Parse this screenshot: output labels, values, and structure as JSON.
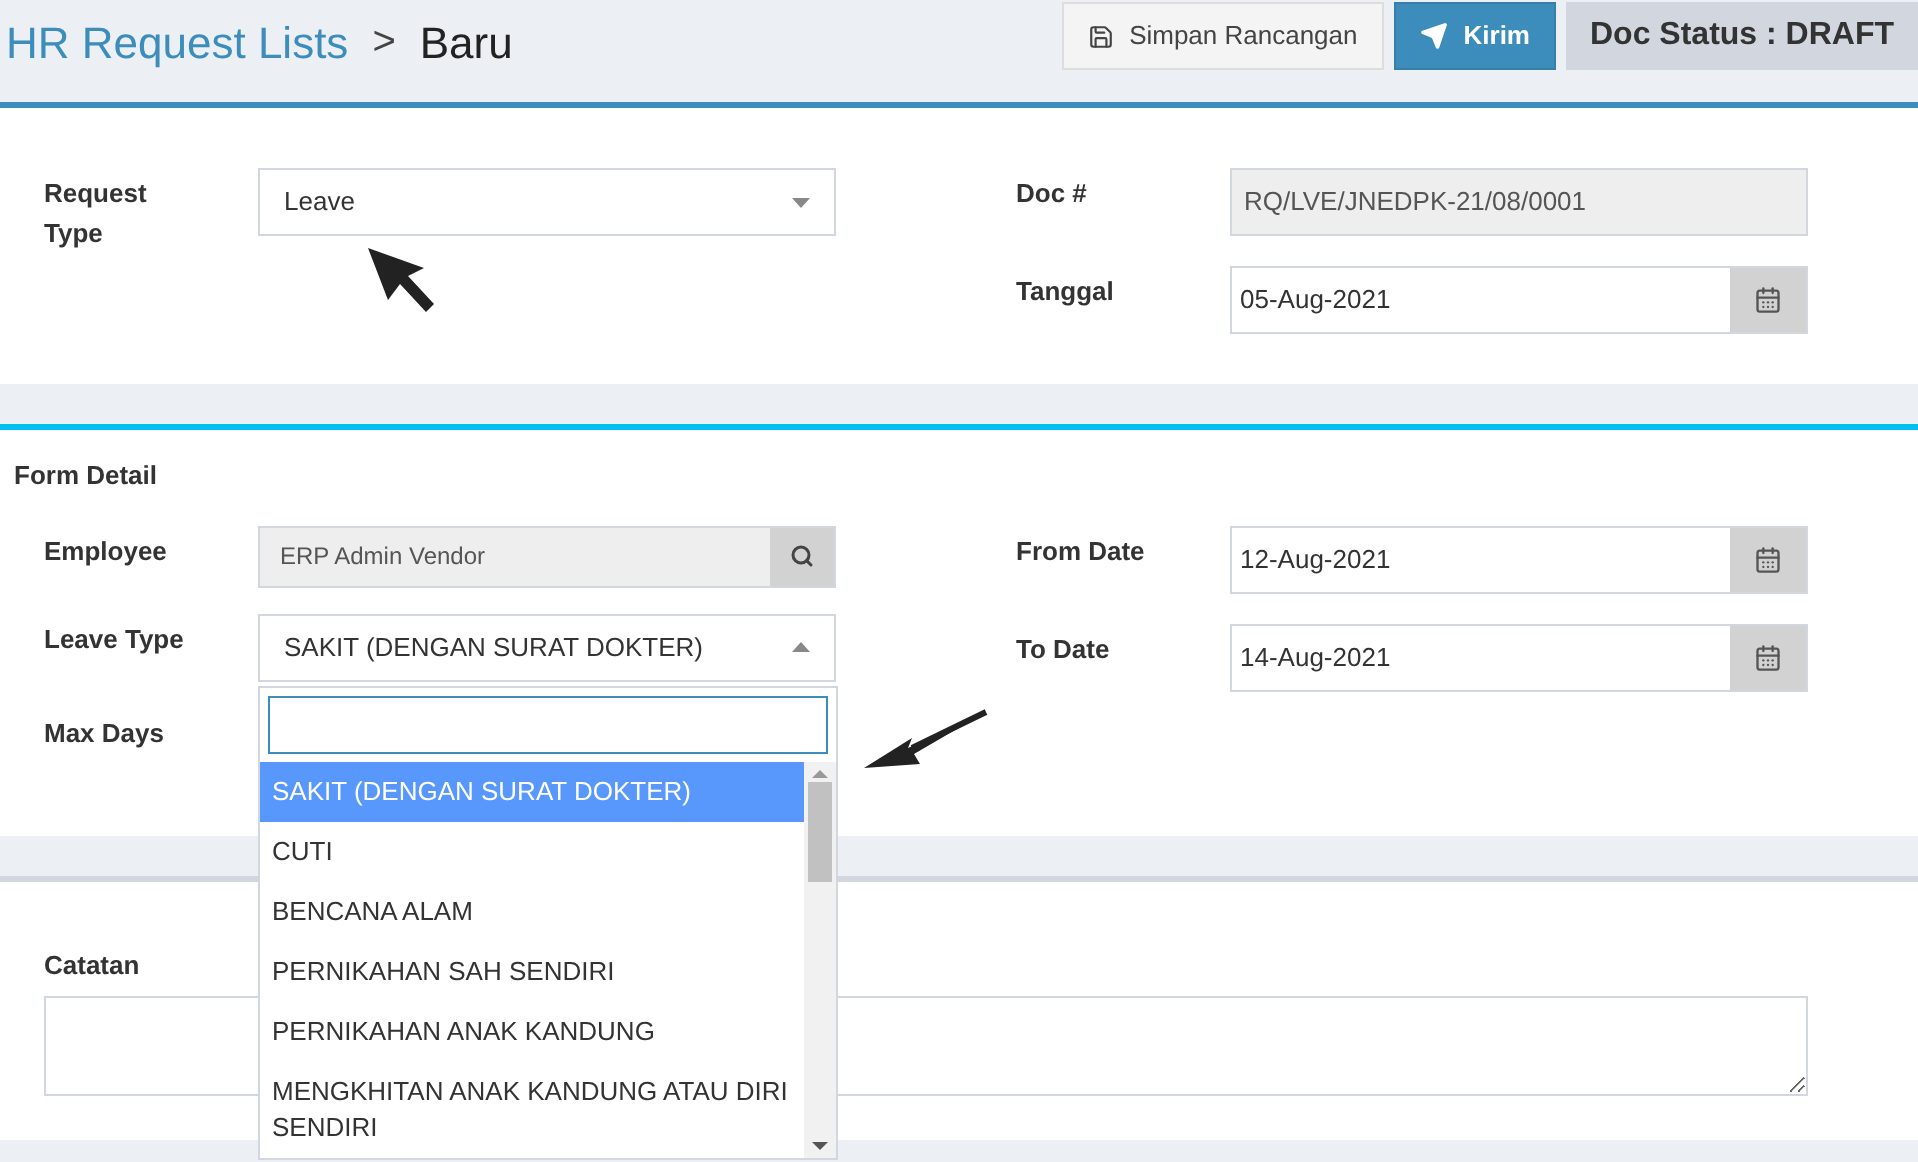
{
  "header": {
    "breadcrumb": "HR Request Lists",
    "separator": ">",
    "title": "Baru",
    "buttons": [
      {
        "label": "Simpan Rancangan",
        "kind": "save"
      },
      {
        "label": "Kirim",
        "kind": "send"
      }
    ],
    "status": "Doc Status : DRAFT"
  },
  "request": {
    "request_type": {
      "label": "Request Type",
      "value": "Leave"
    },
    "doc_no": {
      "label": "Doc #",
      "value": "RQ/LVE/JNEDPK-21/08/0001"
    },
    "tanggal": {
      "label": "Tanggal",
      "value": "05-Aug-2021"
    }
  },
  "form_detail": {
    "title": "Form Detail",
    "employee": {
      "label": "Employee",
      "value": "ERP Admin Vendor"
    },
    "leave_type": {
      "label": "Leave Type",
      "value": "SAKIT (DENGAN SURAT DOKTER)",
      "expanded": true
    },
    "max_days": {
      "label": "Max Days"
    },
    "from_date": {
      "label": "From Date",
      "value": "12-Aug-2021"
    },
    "to_date": {
      "label": "To Date",
      "value": "14-Aug-2021"
    }
  },
  "notes": {
    "label": "Catatan"
  },
  "dropdown_options": [
    {
      "label": "SAKIT (DENGAN SURAT DOKTER)",
      "selected": true
    },
    {
      "label": "CUTI",
      "selected": false
    },
    {
      "label": "BENCANA ALAM",
      "selected": false
    },
    {
      "label": "PERNIKAHAN SAH SENDIRI",
      "selected": false
    },
    {
      "label": "PERNIKAHAN ANAK KANDUNG",
      "selected": false
    },
    {
      "label": "MENGKHITAN ANAK KANDUNG ATAU DIRI SENDIRI",
      "selected": false
    }
  ]
}
